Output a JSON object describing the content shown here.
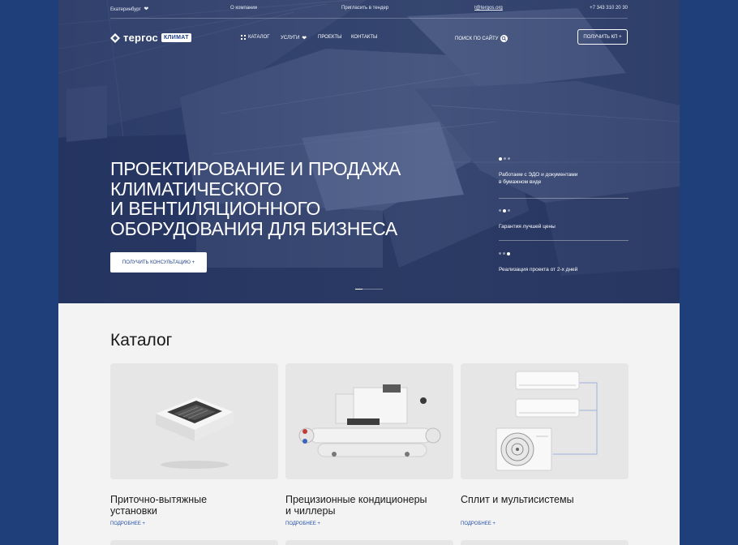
{
  "topbar": {
    "city": "Екатеринбург",
    "about": "О компании",
    "tender": "Пригласить в тендер",
    "email": "t@tergos.org",
    "phone": "+7 343 310 20 30"
  },
  "nav": {
    "logo_text": "тергос",
    "logo_badge": "КЛИМАТ",
    "items": [
      "КАТАЛОГ",
      "УСЛУГИ",
      "ПРОЕКТЫ",
      "КОНТАКТЫ"
    ],
    "search_label": "ПОИСК ПО САЙТУ",
    "cta": "ПОЛУЧИТЬ КП +"
  },
  "hero": {
    "title_lines": [
      "ПРОЕКТИРОВАНИЕ И ПРОДАЖА",
      "КЛИМАТИЧЕСКОГО",
      "И ВЕНТИЛЯЦИОННОГО",
      "ОБОРУДОВАНИЯ ДЛЯ БИЗНЕСА"
    ],
    "button": "ПОЛУЧИТЬ КОНСУЛЬТАЦИЮ +",
    "features": [
      {
        "text_lines": [
          "Работаем с ЭДО и документами",
          "в бумажном виде"
        ],
        "active_dot": 1
      },
      {
        "text_lines": [
          "Гарантия лучшей цены"
        ],
        "active_dot": 2
      },
      {
        "text_lines": [
          "Реализация проекта от 2-х дней"
        ],
        "active_dot": 3
      }
    ]
  },
  "catalog": {
    "title": "Каталог",
    "cards": [
      {
        "title_lines": [
          "Приточно-вытяжные",
          "установки"
        ],
        "more": "ПОДРОБНЕЕ +"
      },
      {
        "title_lines": [
          "Прецизионные кондиционеры",
          "и чиллеры"
        ],
        "more": "ПОДРОБНЕЕ +"
      },
      {
        "title_lines": [
          "Сплит и мультисистемы"
        ],
        "more": "ПОДРОБНЕЕ +"
      }
    ]
  },
  "colors": {
    "frame": "#1e3f7a",
    "accent": "#2450a8",
    "hero": "#3b4b70"
  },
  "icons": [
    "heart-icon",
    "grid-icon",
    "search-icon",
    "logo-mark-icon"
  ]
}
